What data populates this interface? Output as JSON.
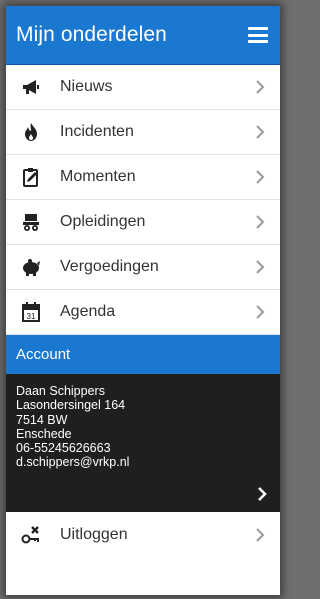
{
  "header": {
    "title": "Mijn onderdelen",
    "menu_icon": "hamburger-icon"
  },
  "menu": [
    {
      "label": "Nieuws",
      "icon": "megaphone-icon"
    },
    {
      "label": "Incidenten",
      "icon": "fire-icon"
    },
    {
      "label": "Momenten",
      "icon": "clipboard-edit-icon"
    },
    {
      "label": "Opleidingen",
      "icon": "training-icon"
    },
    {
      "label": "Vergoedingen",
      "icon": "piggy-bank-icon"
    },
    {
      "label": "Agenda",
      "icon": "calendar-icon"
    }
  ],
  "account": {
    "heading": "Account",
    "name": "Daan Schippers",
    "street": "Lasondersingel 164",
    "postcode": "7514 BW",
    "city": "Enschede",
    "phone": "06-55245626663",
    "email": "d.schippers@vrkp.nl"
  },
  "logout": {
    "label": "Uitloggen",
    "icon": "key-logout-icon"
  },
  "colors": {
    "accent": "#1a78d0",
    "account_bg": "#1f1f1f",
    "text": "#333333",
    "chevron": "#9a9a9a"
  }
}
